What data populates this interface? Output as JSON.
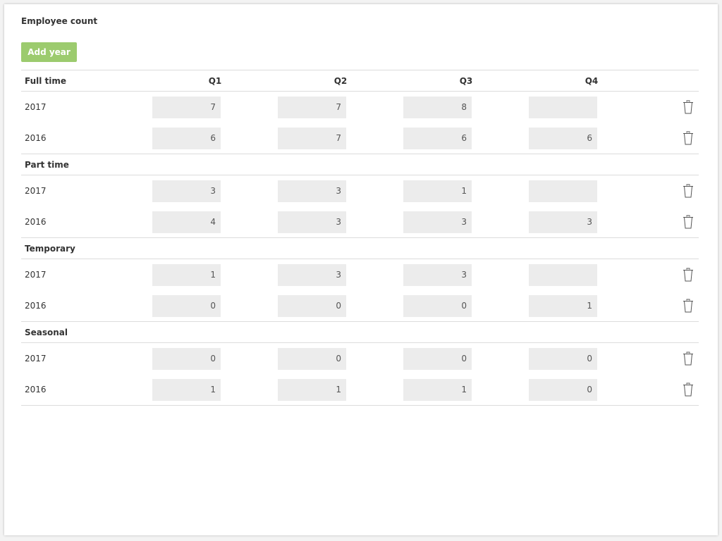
{
  "title": "Employee count",
  "add_button_label": "Add year",
  "columns": [
    "Q1",
    "Q2",
    "Q3",
    "Q4"
  ],
  "groups": [
    {
      "label": "Full time",
      "rows": [
        {
          "year": "2017",
          "values": [
            "7",
            "7",
            "8",
            ""
          ]
        },
        {
          "year": "2016",
          "values": [
            "6",
            "7",
            "6",
            "6"
          ]
        }
      ]
    },
    {
      "label": "Part time",
      "rows": [
        {
          "year": "2017",
          "values": [
            "3",
            "3",
            "1",
            ""
          ]
        },
        {
          "year": "2016",
          "values": [
            "4",
            "3",
            "3",
            "3"
          ]
        }
      ]
    },
    {
      "label": "Temporary",
      "rows": [
        {
          "year": "2017",
          "values": [
            "1",
            "3",
            "3",
            ""
          ]
        },
        {
          "year": "2016",
          "values": [
            "0",
            "0",
            "0",
            "1"
          ]
        }
      ]
    },
    {
      "label": "Seasonal",
      "rows": [
        {
          "year": "2017",
          "values": [
            "0",
            "0",
            "0",
            "0"
          ]
        },
        {
          "year": "2016",
          "values": [
            "1",
            "1",
            "1",
            "0"
          ]
        }
      ]
    }
  ],
  "icons": {
    "delete": "trash-icon"
  },
  "colors": {
    "accent": "#9ccb6e",
    "field_bg": "#ececec"
  }
}
